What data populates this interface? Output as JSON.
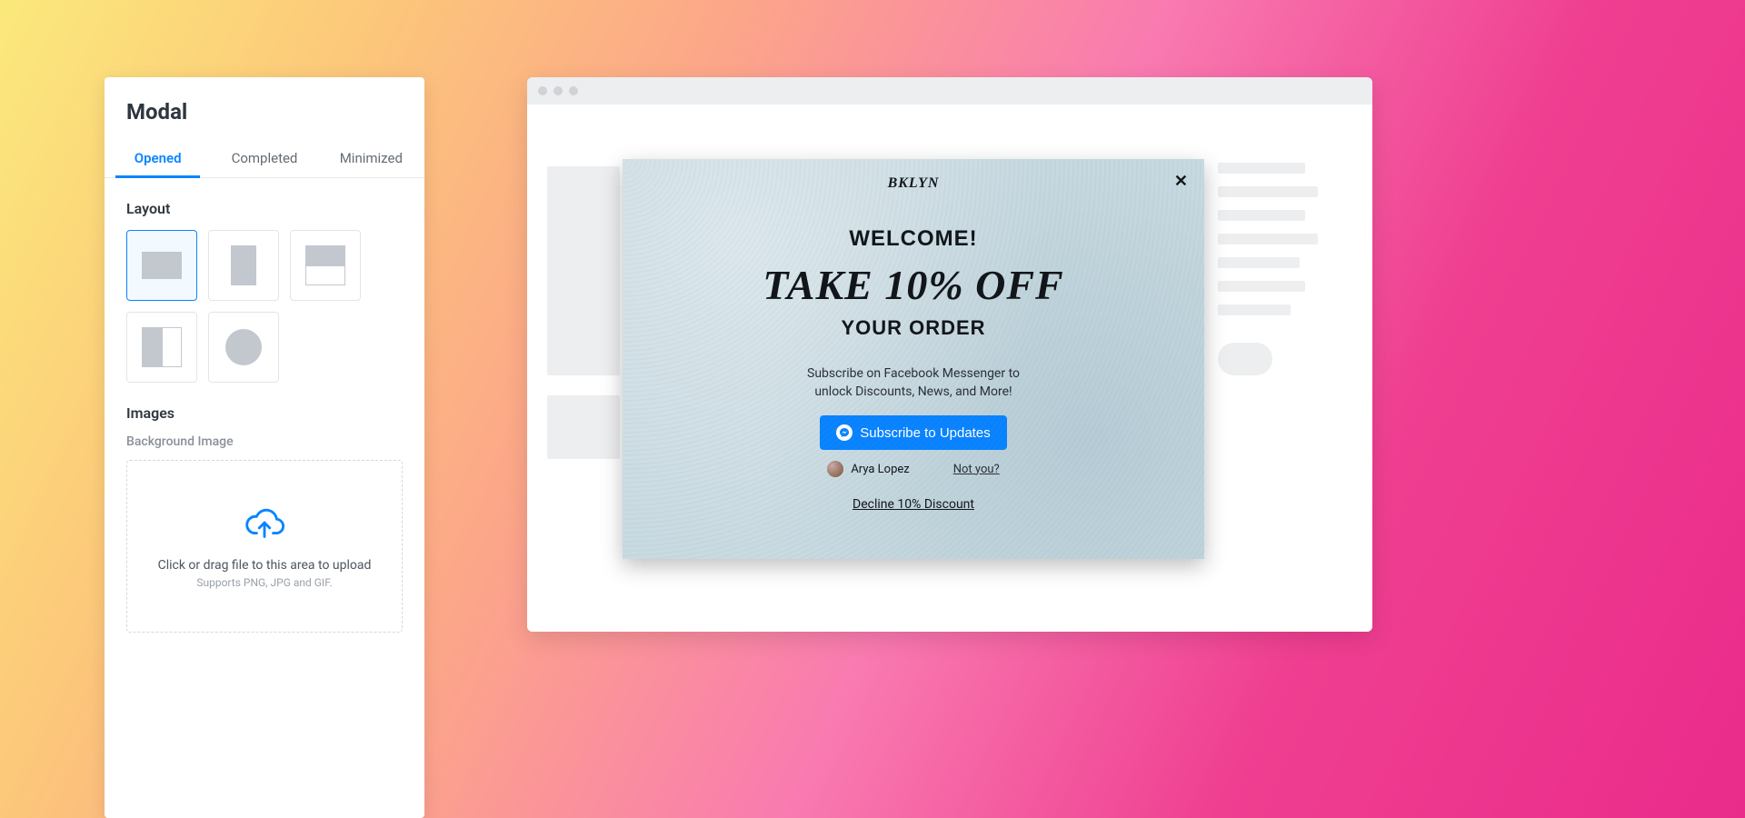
{
  "panel": {
    "title": "Modal",
    "tabs": [
      "Opened",
      "Completed",
      "Minimized"
    ],
    "active_tab_index": 0,
    "layout": {
      "heading": "Layout",
      "options": [
        "landscape",
        "portrait",
        "split-horizontal",
        "split-vertical",
        "circle"
      ],
      "selected_index": 0
    },
    "images": {
      "heading": "Images",
      "sub_label": "Background Image",
      "dropzone_text": "Click or drag file to this area to upload",
      "dropzone_sub": "Supports PNG, JPG and GIF."
    }
  },
  "preview": {
    "brand": "BKLYN",
    "close_glyph": "✕",
    "welcome": "WELCOME!",
    "offer": "TAKE 10% OFF",
    "your_order": "YOUR ORDER",
    "sub_line1": "Subscribe on Facebook Messenger to",
    "sub_line2": "unlock Discounts, News, and More!",
    "subscribe_btn": "Subscribe to Updates",
    "user_name": "Arya Lopez",
    "not_you": "Not you?",
    "decline": "Decline 10% Discount"
  },
  "colors": {
    "accent": "#0a84ff"
  }
}
